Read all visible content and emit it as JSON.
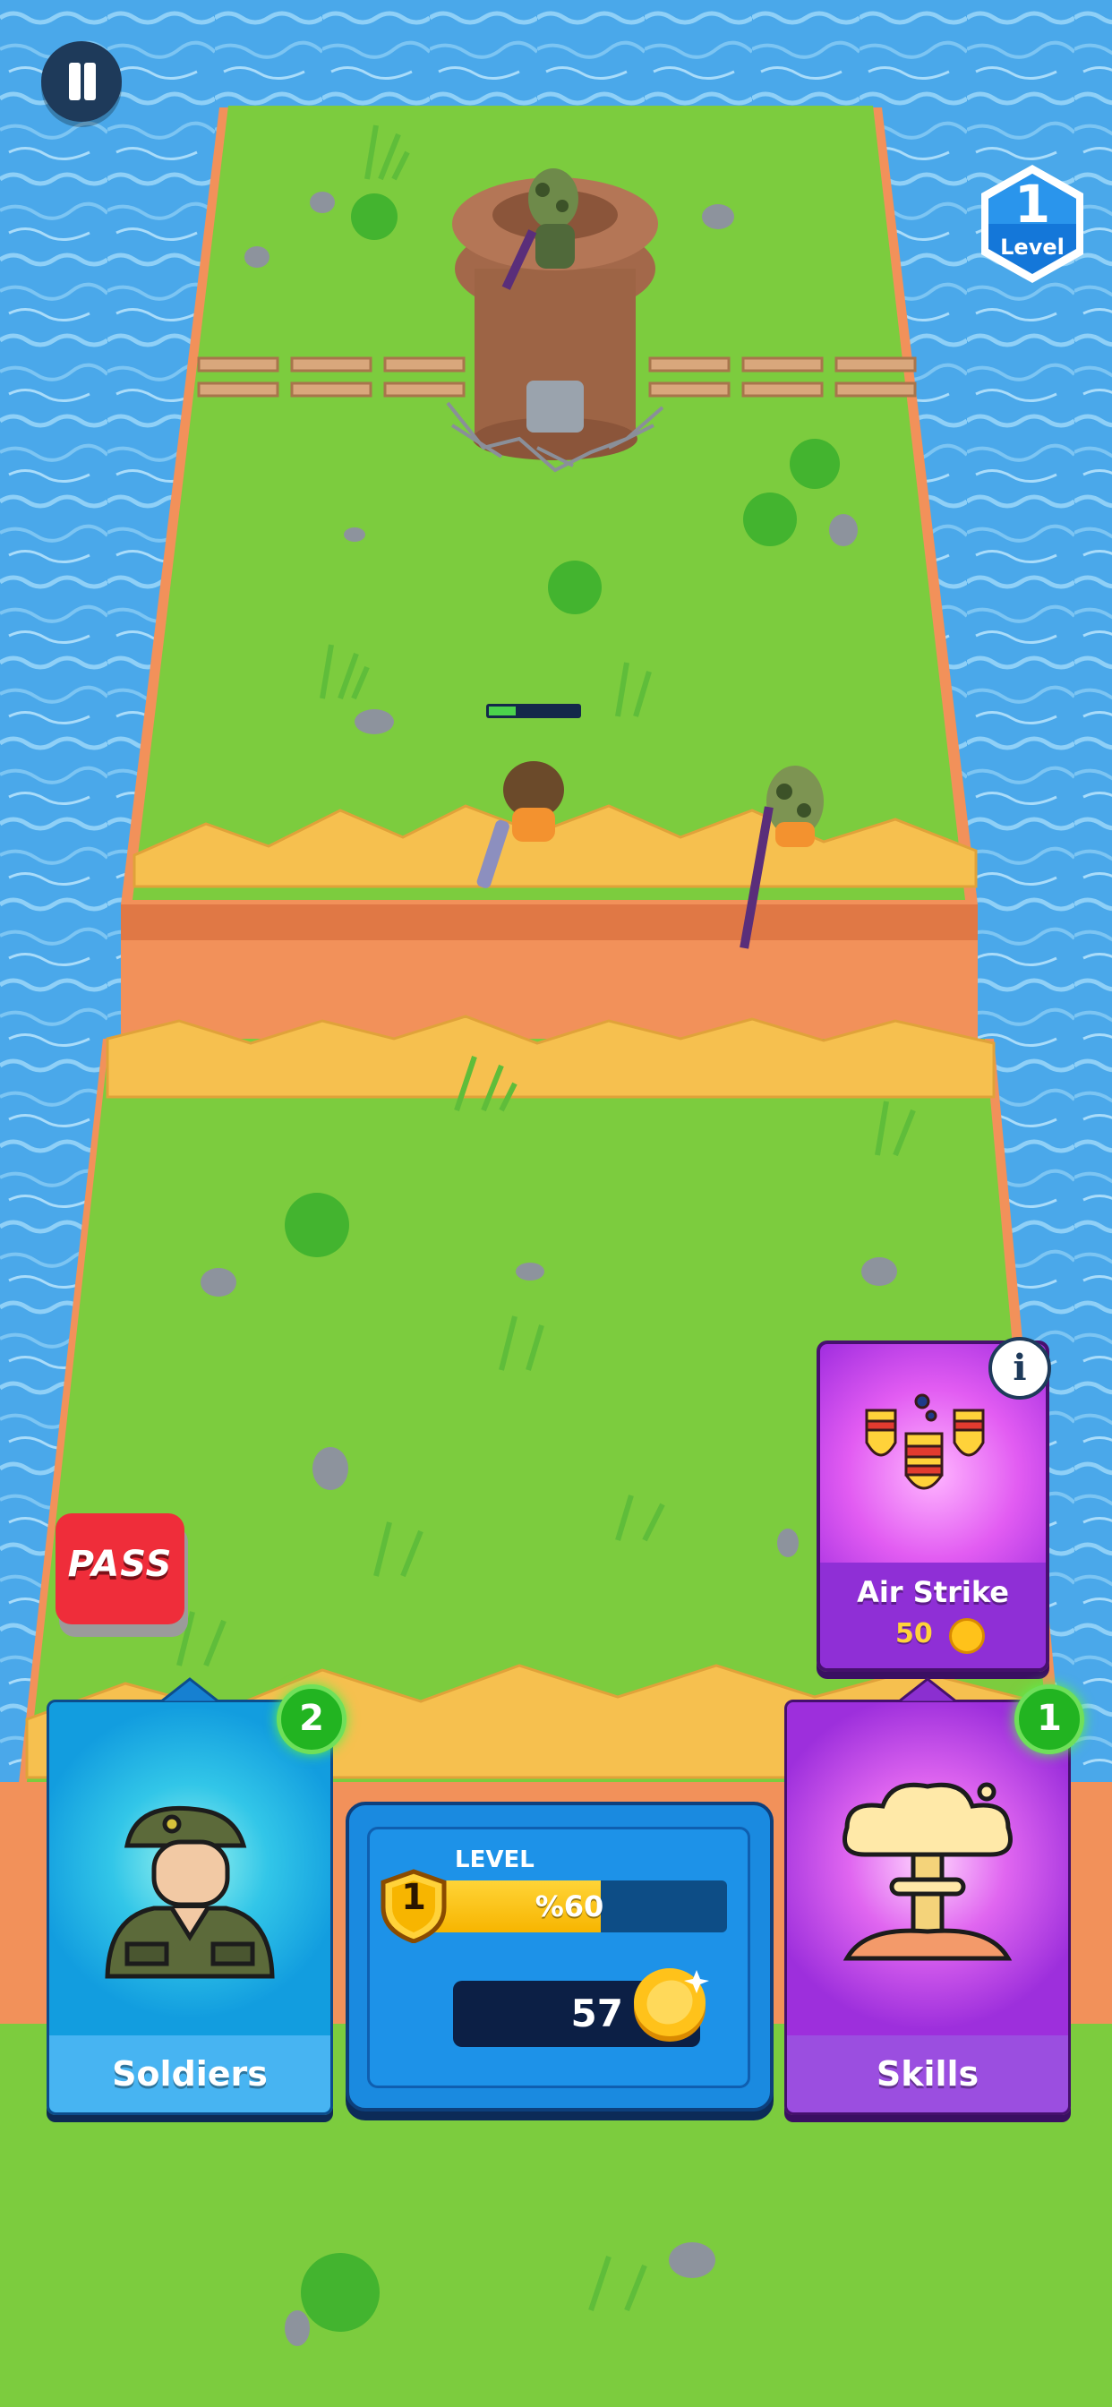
{
  "hud": {
    "level_number": "1",
    "level_label": "Level"
  },
  "pass_button": {
    "label": "PASS"
  },
  "air_strike_card": {
    "title": "Air Strike",
    "cost": "50",
    "info_glyph": "i"
  },
  "cards": {
    "soldiers": {
      "label": "Soldiers",
      "badge": "2"
    },
    "skills": {
      "label": "Skills",
      "badge": "1"
    }
  },
  "progress_panel": {
    "level_label": "LEVEL",
    "level_number": "1",
    "xp_text": "%60",
    "xp_fraction": 0.6,
    "coins": "57"
  },
  "icons": [
    "pause-icon",
    "level-hex-icon",
    "info-icon",
    "bombs-icon",
    "soldier-icon",
    "mushroom-cloud-icon",
    "coin-icon",
    "level-shield-icon"
  ],
  "colors": {
    "water": "#4aa8ea",
    "grass": "#7ccc3e",
    "dirt": "#f2915a",
    "soldiers_card": "#129ddf",
    "skills_card": "#9d2fdc",
    "pass": "#ef2d3a",
    "badge": "#22b421",
    "xp_fill": "#f7b500"
  }
}
